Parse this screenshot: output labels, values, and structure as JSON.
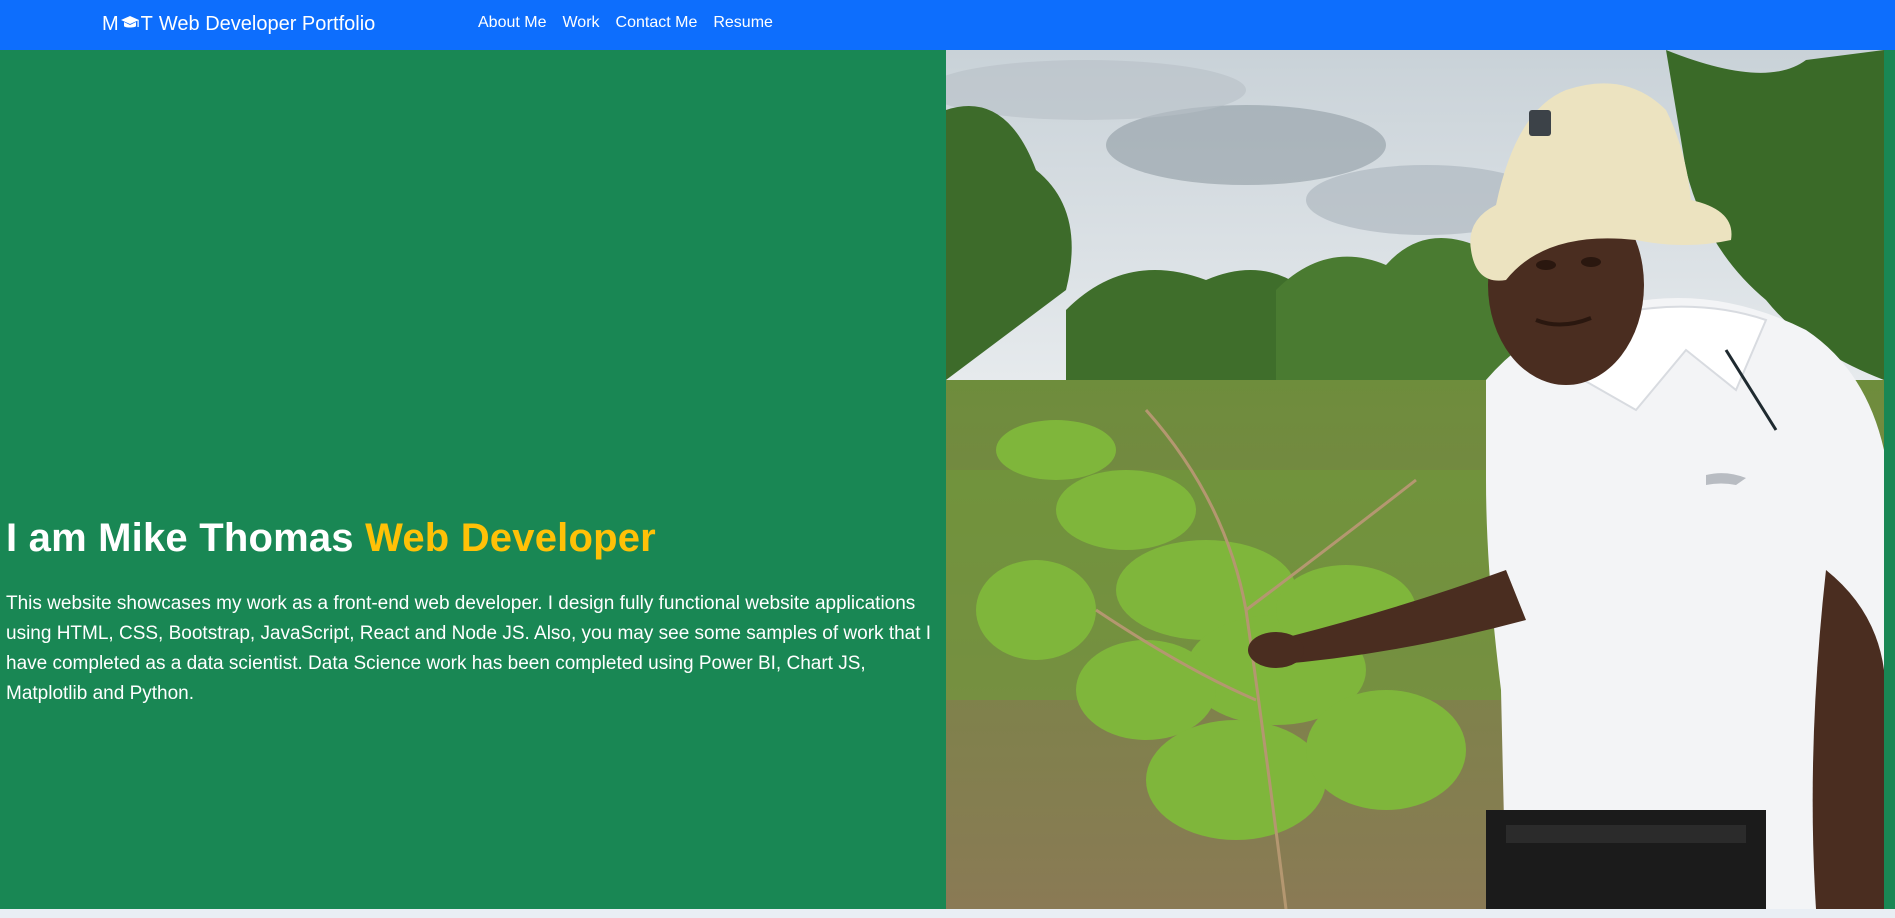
{
  "navbar": {
    "brand_logo": "M❖T",
    "brand_title": "Web Developer Portfolio",
    "links": [
      "About Me",
      "Work",
      "Contact Me",
      "Resume"
    ]
  },
  "hero": {
    "title_main": "I am Mike Thomas",
    "title_accent": "Web Developer",
    "description": "This website showcases my work as a front-end web developer. I design fully functional website applications using HTML, CSS, Bootstrap, JavaScript, React and Node JS. Also, you may see some samples of work that I have completed as a data scientist. Data Science work has been completed using Power BI, Chart JS, Matplotlib and Python."
  },
  "colors": {
    "navbar": "#0d6efd",
    "hero_background": "#198754",
    "accent": "#ffc107"
  },
  "icons": {
    "brand": "graduation-cap-icon",
    "photo": "portrait-photo"
  }
}
